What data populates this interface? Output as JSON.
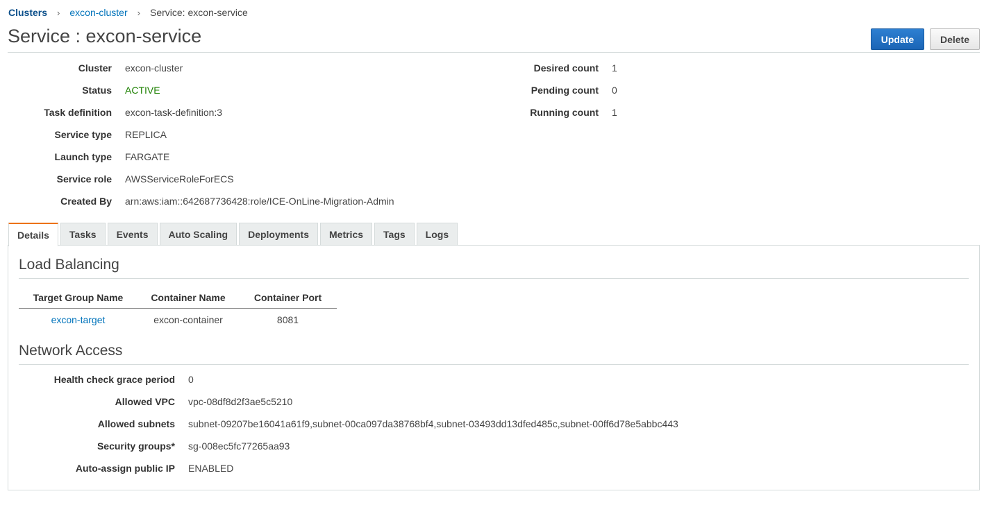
{
  "breadcrumb": {
    "items": [
      "Clusters",
      "excon-cluster",
      "Service: excon-service"
    ],
    "separator": "›"
  },
  "page": {
    "title": "Service : excon-service",
    "update_label": "Update",
    "delete_label": "Delete"
  },
  "summary": {
    "cluster": {
      "label": "Cluster",
      "value": "excon-cluster"
    },
    "status": {
      "label": "Status",
      "value": "ACTIVE"
    },
    "task_definition": {
      "label": "Task definition",
      "value": "excon-task-definition:3"
    },
    "service_type": {
      "label": "Service type",
      "value": "REPLICA"
    },
    "launch_type": {
      "label": "Launch type",
      "value": "FARGATE"
    },
    "service_role": {
      "label": "Service role",
      "value": "AWSServiceRoleForECS"
    },
    "created_by": {
      "label": "Created By",
      "value": "arn:aws:iam::642687736428:role/ICE-OnLine-Migration-Admin"
    },
    "desired_count": {
      "label": "Desired count",
      "value": "1"
    },
    "pending_count": {
      "label": "Pending count",
      "value": "0"
    },
    "running_count": {
      "label": "Running count",
      "value": "1"
    }
  },
  "tabs": [
    "Details",
    "Tasks",
    "Events",
    "Auto Scaling",
    "Deployments",
    "Metrics",
    "Tags",
    "Logs"
  ],
  "load_balancing": {
    "title": "Load Balancing",
    "columns": [
      "Target Group Name",
      "Container Name",
      "Container Port"
    ],
    "row": [
      "excon-target",
      "excon-container",
      "8081"
    ]
  },
  "network": {
    "title": "Network Access",
    "health_check": {
      "label": "Health check grace period",
      "value": "0"
    },
    "vpc": {
      "label": "Allowed VPC",
      "value": "vpc-08df8d2f3ae5c5210"
    },
    "subnets": {
      "label": "Allowed subnets",
      "value": "subnet-09207be16041a61f9,subnet-00ca097da38768bf4,subnet-03493dd13dfed485c,subnet-00ff6d78e5abbc443"
    },
    "security_groups": {
      "label": "Security groups*",
      "value": "sg-008ec5fc77265aa93"
    },
    "public_ip": {
      "label": "Auto-assign public IP",
      "value": "ENABLED"
    }
  },
  "colors": {
    "link": "#0073bb",
    "active_status": "#1d8102",
    "primary_button": "#1b65b6",
    "selected_tab_accent": "#ec7211"
  }
}
